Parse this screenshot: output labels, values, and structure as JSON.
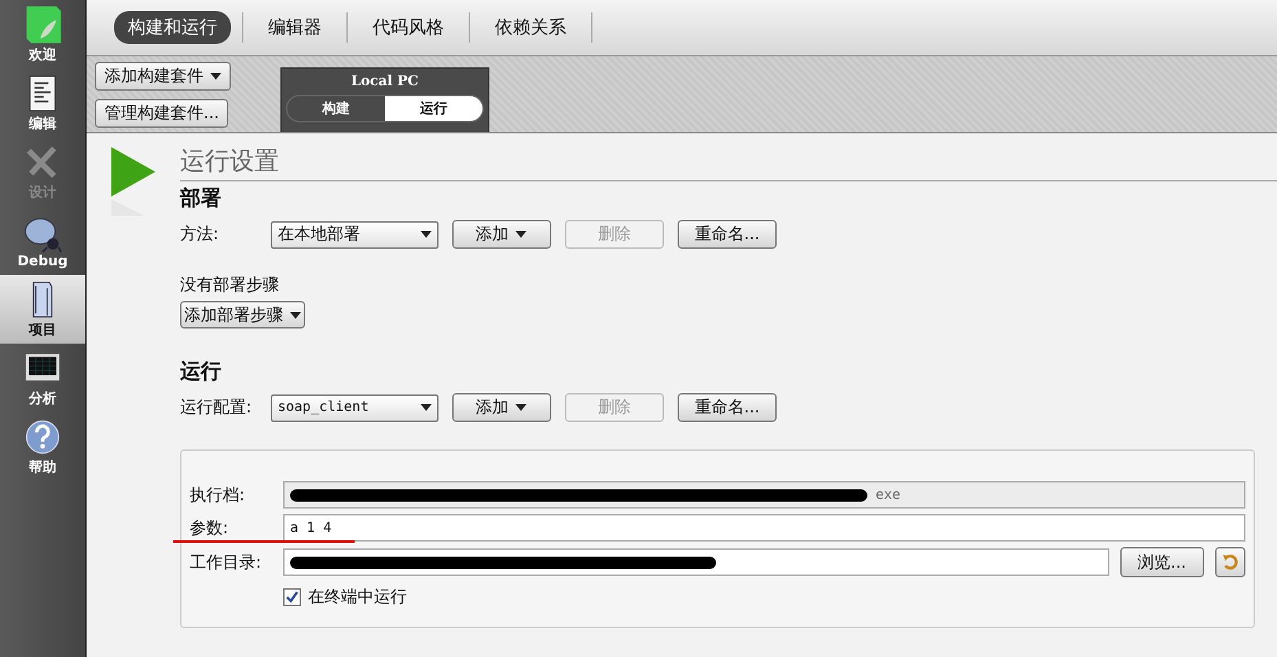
{
  "sidebar": {
    "items": [
      {
        "label": "欢迎",
        "selected": false,
        "disabled": false
      },
      {
        "label": "编辑",
        "selected": false,
        "disabled": false
      },
      {
        "label": "设计",
        "selected": false,
        "disabled": true
      },
      {
        "label": "Debug",
        "selected": false,
        "disabled": false
      },
      {
        "label": "项目",
        "selected": true,
        "disabled": false
      },
      {
        "label": "分析",
        "selected": false,
        "disabled": false
      },
      {
        "label": "帮助",
        "selected": false,
        "disabled": false
      }
    ]
  },
  "tabs": [
    {
      "label": "构建和运行",
      "selected": true
    },
    {
      "label": "编辑器",
      "selected": false
    },
    {
      "label": "代码风格",
      "selected": false
    },
    {
      "label": "依赖关系",
      "selected": false
    }
  ],
  "kit_buttons": [
    {
      "label": "添加构建套件",
      "dropdown": true
    },
    {
      "label": "管理构建套件...",
      "dropdown": false
    }
  ],
  "target": {
    "name": "Local PC",
    "modes": [
      {
        "label": "构建",
        "selected": false
      },
      {
        "label": "运行",
        "selected": true
      }
    ]
  },
  "page_title": "运行设置",
  "sections": [
    {
      "heading": "部署",
      "field_label": "方法:",
      "combo": "在本地部署",
      "mono": false,
      "buttons": [
        {
          "label": "添加",
          "dropdown": true,
          "disabled": false
        },
        {
          "label": "删除",
          "dropdown": false,
          "disabled": true
        },
        {
          "label": "重命名...",
          "dropdown": false,
          "disabled": false
        }
      ],
      "note": "没有部署步骤",
      "add_step": "添加部署步骤"
    },
    {
      "heading": "运行",
      "field_label": "运行配置:",
      "combo": "soap_client",
      "mono": true,
      "buttons": [
        {
          "label": "添加",
          "dropdown": true,
          "disabled": false
        },
        {
          "label": "删除",
          "dropdown": false,
          "disabled": true
        },
        {
          "label": "重命名...",
          "dropdown": false,
          "disabled": false
        }
      ]
    }
  ],
  "run_form": {
    "executable": {
      "label": "执行档:",
      "value": "exe",
      "redacted": true
    },
    "arguments": {
      "label": "参数:",
      "value": "a 1 4",
      "underlined": true
    },
    "working_dir": {
      "label": "工作目录:",
      "redacted": true,
      "browse": "浏览..."
    },
    "terminal": {
      "label": "在终端中运行",
      "checked": true
    }
  }
}
